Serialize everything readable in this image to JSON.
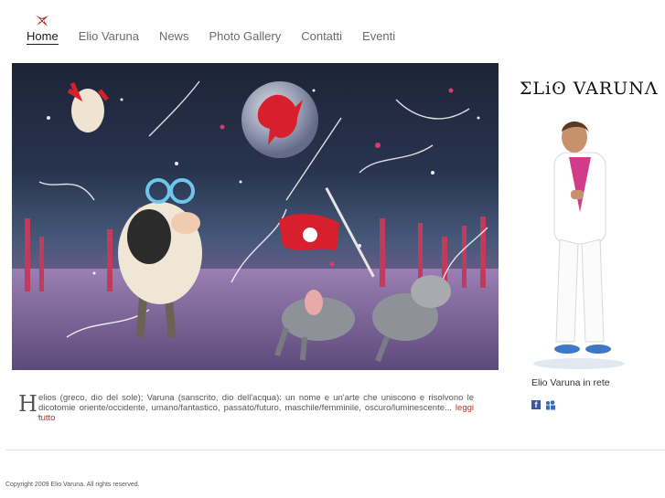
{
  "nav": {
    "items": [
      "Home",
      "Elio Varuna",
      "News",
      "Photo Gallery",
      "Contatti",
      "Eventi"
    ]
  },
  "brand": {
    "title": "ΣLiʘ VARUNΛ"
  },
  "intro": {
    "dropcap": "H",
    "text": "elios (greco, dio del sole); Varuna (sanscrito, dio dell'acqua): un nome e un'arte che uniscono e risolvono le dicotomie oriente/occidente, umano/fantastico, passato/futuro, maschile/femminile, oscuro/luminescente... ",
    "read_more": "leggi tutto",
    "plus": "+"
  },
  "sidebar": {
    "caption": "Elio Varuna in rete",
    "icons": [
      "facebook-icon",
      "myspace-icon"
    ]
  },
  "footer": {
    "copyright": "Copyright 2009 Elio Varuna. All rights reserved."
  },
  "colors": {
    "accent": "#c0302c",
    "facebook": "#3b5998"
  }
}
